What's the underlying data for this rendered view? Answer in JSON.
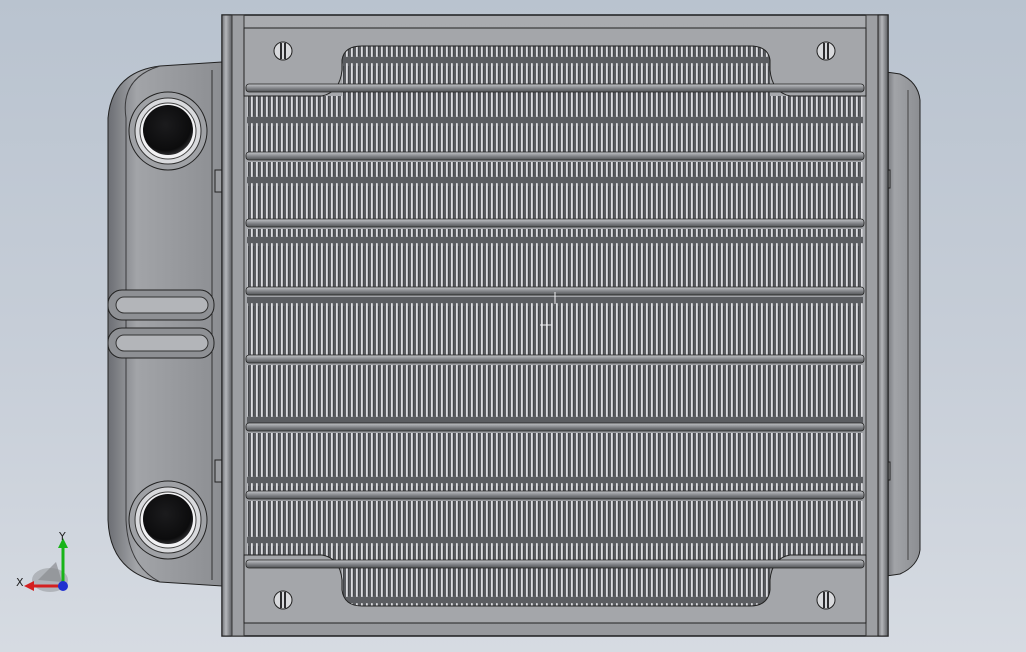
{
  "viewport": {
    "background_top": "#b9c3cf",
    "background_bottom": "#d6dbe2",
    "model": {
      "type": "radiator",
      "view": "front",
      "display_style": "shaded-with-edges",
      "core_rows": 7,
      "inlet_ports": 2,
      "mounting_holes": 4
    },
    "triad": {
      "x_label": "X",
      "y_label": "Y",
      "x_color": "#d42020",
      "y_color": "#18b418",
      "z_color": "#2030d0"
    }
  }
}
